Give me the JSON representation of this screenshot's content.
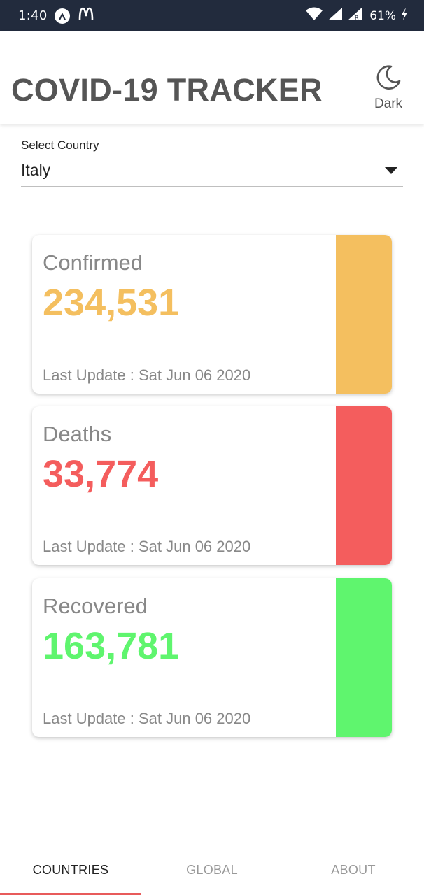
{
  "status_bar": {
    "time": "1:40",
    "battery": "61%",
    "icons": [
      "app-badge-icon",
      "mcdonalds-icon",
      "wifi-icon",
      "signal-icon",
      "signal-roaming-icon",
      "charging-icon"
    ]
  },
  "header": {
    "title": "COVID-19 TRACKER",
    "theme_toggle": {
      "label": "Dark",
      "icon": "moon-icon"
    }
  },
  "country_select": {
    "label": "Select Country",
    "value": "Italy",
    "icon": "caret-down-icon"
  },
  "cards": [
    {
      "title": "Confirmed",
      "value": "234,531",
      "last_update": "Last Update : Sat Jun 06 2020",
      "color": "#f4bf5f"
    },
    {
      "title": "Deaths",
      "value": "33,774",
      "last_update": "Last Update : Sat Jun 06 2020",
      "color": "#f45d5d"
    },
    {
      "title": "Recovered",
      "value": "163,781",
      "last_update": "Last Update : Sat Jun 06 2020",
      "color": "#5ff56e"
    }
  ],
  "bottom_nav": {
    "tabs": [
      {
        "label": "COUNTRIES",
        "active": true
      },
      {
        "label": "GLOBAL",
        "active": false
      },
      {
        "label": "ABOUT",
        "active": false
      }
    ],
    "indicator_color": "#e85b5b"
  }
}
